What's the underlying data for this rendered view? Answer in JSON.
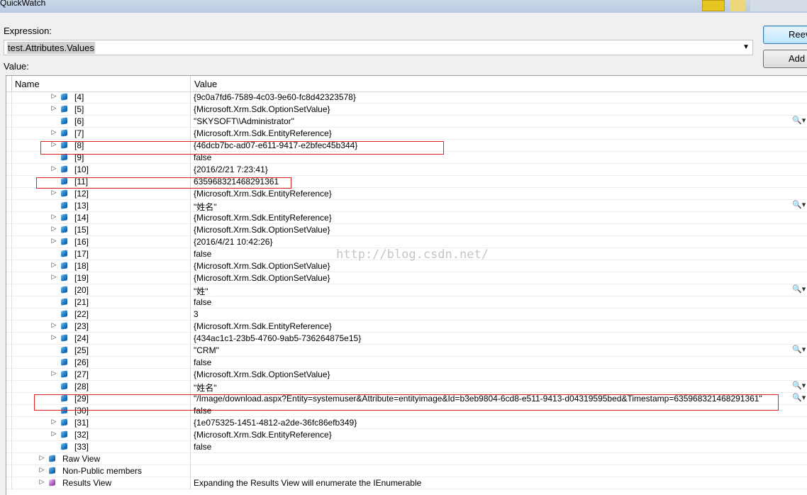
{
  "window": {
    "title": "QuickWatch"
  },
  "expression": {
    "label": "Expression:",
    "value": "test.Attributes.Values",
    "dropdown_icon": "chevron-down-icon"
  },
  "value_label": "Value:",
  "buttons": {
    "reevaluate": "Reev",
    "add": "Add"
  },
  "columns": {
    "name": "Name",
    "value": "Value"
  },
  "rows": [
    {
      "name": "[4]",
      "value": "{9c0a7fd6-7589-4c03-9e60-fc8d42323578}",
      "expander": true,
      "magnifier": false
    },
    {
      "name": "[5]",
      "value": "{Microsoft.Xrm.Sdk.OptionSetValue}",
      "expander": true,
      "magnifier": false
    },
    {
      "name": "[6]",
      "value": "\"SKYSOFT\\\\Administrator\"",
      "expander": false,
      "magnifier": true
    },
    {
      "name": "[7]",
      "value": "{Microsoft.Xrm.Sdk.EntityReference}",
      "expander": true,
      "magnifier": false
    },
    {
      "name": "[8]",
      "value": "{46dcb7bc-ad07-e611-9417-e2bfec45b344}",
      "expander": true,
      "magnifier": false
    },
    {
      "name": "[9]",
      "value": "false",
      "expander": false,
      "magnifier": false
    },
    {
      "name": "[10]",
      "value": "{2016/2/21 7:23:41}",
      "expander": true,
      "magnifier": false
    },
    {
      "name": "[11]",
      "value": "635968321468291361",
      "expander": false,
      "magnifier": false
    },
    {
      "name": "[12]",
      "value": "{Microsoft.Xrm.Sdk.EntityReference}",
      "expander": true,
      "magnifier": false
    },
    {
      "name": "[13]",
      "value": "\"姓名\"",
      "expander": false,
      "magnifier": true
    },
    {
      "name": "[14]",
      "value": "{Microsoft.Xrm.Sdk.EntityReference}",
      "expander": true,
      "magnifier": false
    },
    {
      "name": "[15]",
      "value": "{Microsoft.Xrm.Sdk.OptionSetValue}",
      "expander": true,
      "magnifier": false
    },
    {
      "name": "[16]",
      "value": "{2016/4/21 10:42:26}",
      "expander": true,
      "magnifier": false
    },
    {
      "name": "[17]",
      "value": "false",
      "expander": false,
      "magnifier": false
    },
    {
      "name": "[18]",
      "value": "{Microsoft.Xrm.Sdk.OptionSetValue}",
      "expander": true,
      "magnifier": false
    },
    {
      "name": "[19]",
      "value": "{Microsoft.Xrm.Sdk.OptionSetValue}",
      "expander": true,
      "magnifier": false
    },
    {
      "name": "[20]",
      "value": "\"姓\"",
      "expander": false,
      "magnifier": true
    },
    {
      "name": "[21]",
      "value": "false",
      "expander": false,
      "magnifier": false
    },
    {
      "name": "[22]",
      "value": "3",
      "expander": false,
      "magnifier": false
    },
    {
      "name": "[23]",
      "value": "{Microsoft.Xrm.Sdk.EntityReference}",
      "expander": true,
      "magnifier": false
    },
    {
      "name": "[24]",
      "value": "{434ac1c1-23b5-4760-9ab5-736264875e15}",
      "expander": true,
      "magnifier": false
    },
    {
      "name": "[25]",
      "value": "\"CRM\"",
      "expander": false,
      "magnifier": true
    },
    {
      "name": "[26]",
      "value": "false",
      "expander": false,
      "magnifier": false
    },
    {
      "name": "[27]",
      "value": "{Microsoft.Xrm.Sdk.OptionSetValue}",
      "expander": true,
      "magnifier": false
    },
    {
      "name": "[28]",
      "value": "\"姓名\"",
      "expander": false,
      "magnifier": true
    },
    {
      "name": "[29]",
      "value": "\"/Image/download.aspx?Entity=systemuser&Attribute=entityimage&Id=b3eb9804-6cd8-e511-9413-d04319595bed&Timestamp=635968321468291361\"",
      "expander": false,
      "magnifier": true
    },
    {
      "name": "[30]",
      "value": "false",
      "expander": false,
      "magnifier": false
    },
    {
      "name": "[31]",
      "value": "{1e075325-1451-4812-a2de-36fc86efb349}",
      "expander": true,
      "magnifier": false
    },
    {
      "name": "[32]",
      "value": "{Microsoft.Xrm.Sdk.EntityReference}",
      "expander": true,
      "magnifier": false
    },
    {
      "name": "[33]",
      "value": "false",
      "expander": false,
      "magnifier": false
    },
    {
      "name": "Raw View",
      "value": "",
      "expander": true,
      "magnifier": false
    },
    {
      "name": "Non-Public members",
      "value": "",
      "expander": true,
      "magnifier": false
    },
    {
      "name": "Results View",
      "value": "Expanding the Results View will enumerate the IEnumerable",
      "expander": true,
      "magnifier": false
    }
  ],
  "watermark": "http://blog.csdn.net/"
}
